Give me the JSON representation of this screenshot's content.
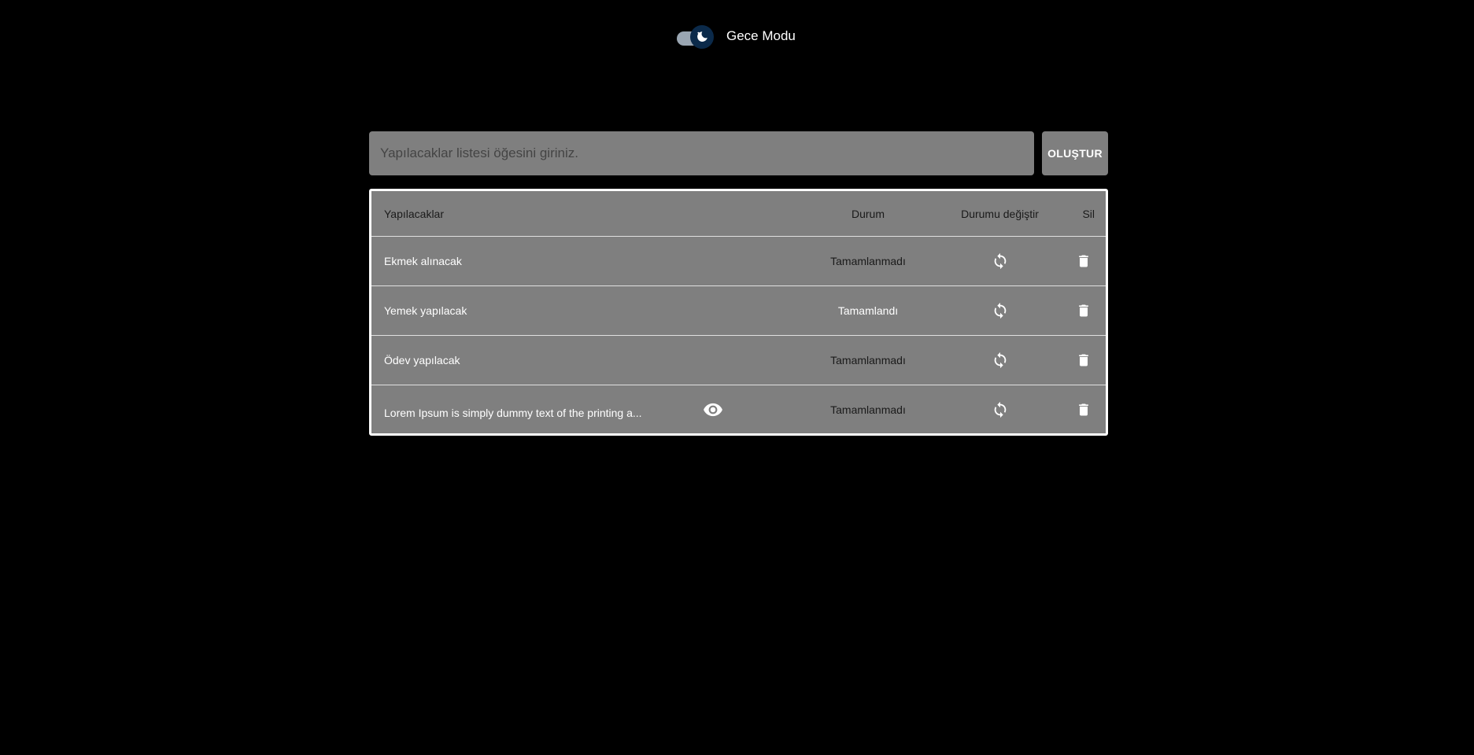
{
  "theme": {
    "background": "#000000",
    "surface": "#7f7f7f",
    "text_light": "#ffffff",
    "text_dark": "#1a1a1a",
    "toggle_thumb": "#0b2a4a"
  },
  "night_mode": {
    "label": "Gece Modu",
    "enabled": true,
    "icon": "moon-icon"
  },
  "create": {
    "placeholder": "Yapılacaklar listesi öğesini giriniz.",
    "value": "",
    "button_label": "OLUŞTUR"
  },
  "table": {
    "headers": {
      "task": "Yapılacaklar",
      "status": "Durum",
      "toggle": "Durumu değiştir",
      "delete": "Sil"
    },
    "rows": [
      {
        "task": "Ekmek alınacak",
        "status": "Tamamlanmadı",
        "done": false,
        "has_view_icon": false
      },
      {
        "task": "Yemek yapılacak",
        "status": "Tamamlandı",
        "done": true,
        "has_view_icon": false
      },
      {
        "task": "Ödev yapılacak",
        "status": "Tamamlanmadı",
        "done": false,
        "has_view_icon": false
      },
      {
        "task": "Lorem Ipsum is simply dummy text of the printing a...",
        "status": "Tamamlanmadı",
        "done": false,
        "has_view_icon": true
      }
    ],
    "icons": {
      "toggle": "sync-icon",
      "delete": "trash-icon",
      "view": "eye-icon"
    }
  }
}
